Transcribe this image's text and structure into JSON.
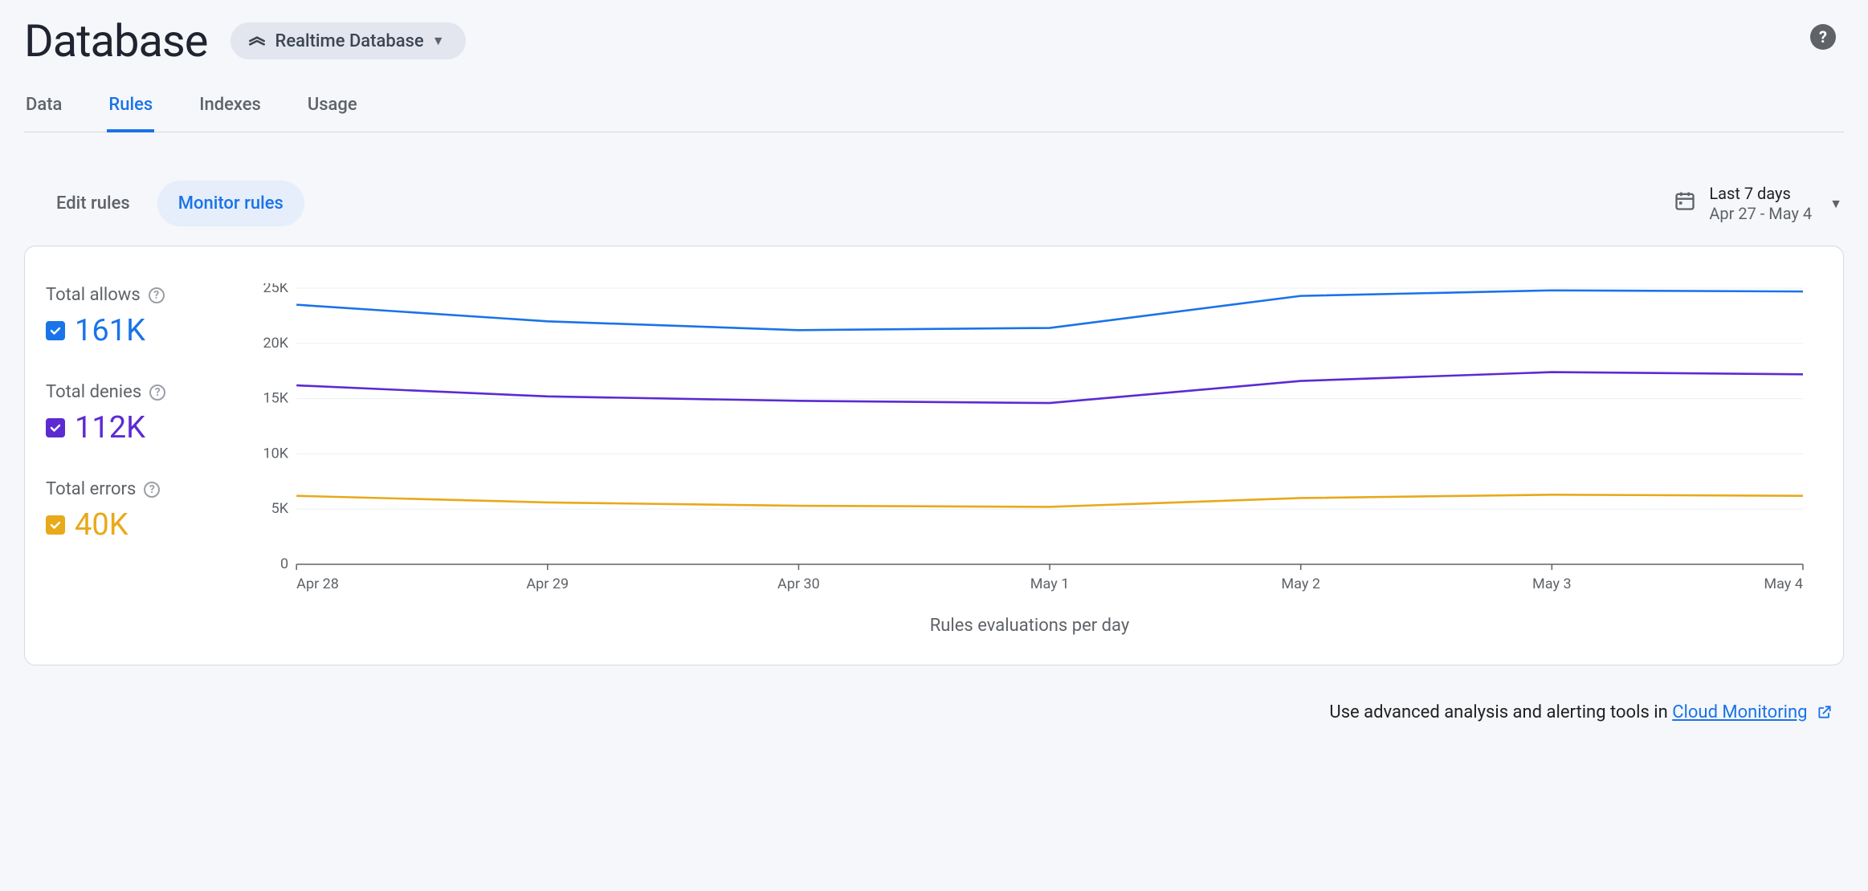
{
  "header": {
    "title": "Database",
    "product_pill": "Realtime Database"
  },
  "tabs": [
    "Data",
    "Rules",
    "Indexes",
    "Usage"
  ],
  "active_tab": 1,
  "subtabs": [
    "Edit rules",
    "Monitor rules"
  ],
  "active_subtab": 1,
  "date_picker": {
    "label": "Last 7 days",
    "range": "Apr 27 - May 4"
  },
  "metrics": {
    "allows": {
      "label": "Total allows",
      "value": "161K",
      "color": "#1a73e8"
    },
    "denies": {
      "label": "Total denies",
      "value": "112K",
      "color": "#5b2bd1"
    },
    "errors": {
      "label": "Total errors",
      "value": "40K",
      "color": "#e8a91a"
    }
  },
  "chart_data": {
    "type": "line",
    "title": "",
    "xlabel": "Rules evaluations per day",
    "ylabel": "",
    "ylim": [
      0,
      25000
    ],
    "y_ticks": [
      0,
      5000,
      10000,
      15000,
      20000,
      25000
    ],
    "y_tick_labels": [
      "0",
      "5K",
      "10K",
      "15K",
      "20K",
      "25K"
    ],
    "categories": [
      "Apr 28",
      "Apr 29",
      "Apr 30",
      "May 1",
      "May 2",
      "May 3",
      "May 4"
    ],
    "series": [
      {
        "name": "Total allows",
        "color": "#1a73e8",
        "values": [
          23500,
          22000,
          21200,
          21400,
          24300,
          24800,
          24700
        ]
      },
      {
        "name": "Total denies",
        "color": "#5b2bd1",
        "values": [
          16200,
          15200,
          14800,
          14600,
          16600,
          17400,
          17200
        ]
      },
      {
        "name": "Total errors",
        "color": "#e8a91a",
        "values": [
          6200,
          5600,
          5300,
          5200,
          6000,
          6300,
          6200
        ]
      }
    ]
  },
  "footer": {
    "text": "Use advanced analysis and alerting tools in ",
    "link_text": "Cloud Monitoring"
  }
}
